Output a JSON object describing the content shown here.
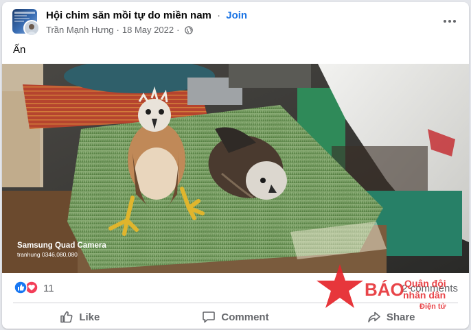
{
  "post": {
    "group_name": "Hội chim săn mồi tự do miền nam",
    "separator": "·",
    "join_label": "Join",
    "author": "Trần Mạnh Hưng",
    "date": "18 May 2022",
    "meta_separator": "·",
    "privacy_icon": "globe-icon",
    "text": "Ấn"
  },
  "photo": {
    "camera_logo": "◎◎◎◎",
    "camera_label": "Samsung Quad Camera",
    "camera_sub": "tranhung 0346,080,080"
  },
  "engagement": {
    "reaction_icons": [
      "like-icon",
      "love-icon"
    ],
    "reaction_count": "11",
    "comments_label": "2 comments"
  },
  "actions": {
    "like_label": "Like",
    "comment_label": "Comment",
    "share_label": "Share"
  },
  "watermark": {
    "brand_main": "BÁO",
    "brand_top": "Quân đội",
    "brand_mid": "nhân dân",
    "brand_sub": "Điện tử"
  },
  "colors": {
    "accent": "#1b74e4",
    "secondary_text": "#65676b",
    "like_blue": "#1877f2",
    "love_red": "#f33e58",
    "watermark_red": "#e5252a"
  }
}
